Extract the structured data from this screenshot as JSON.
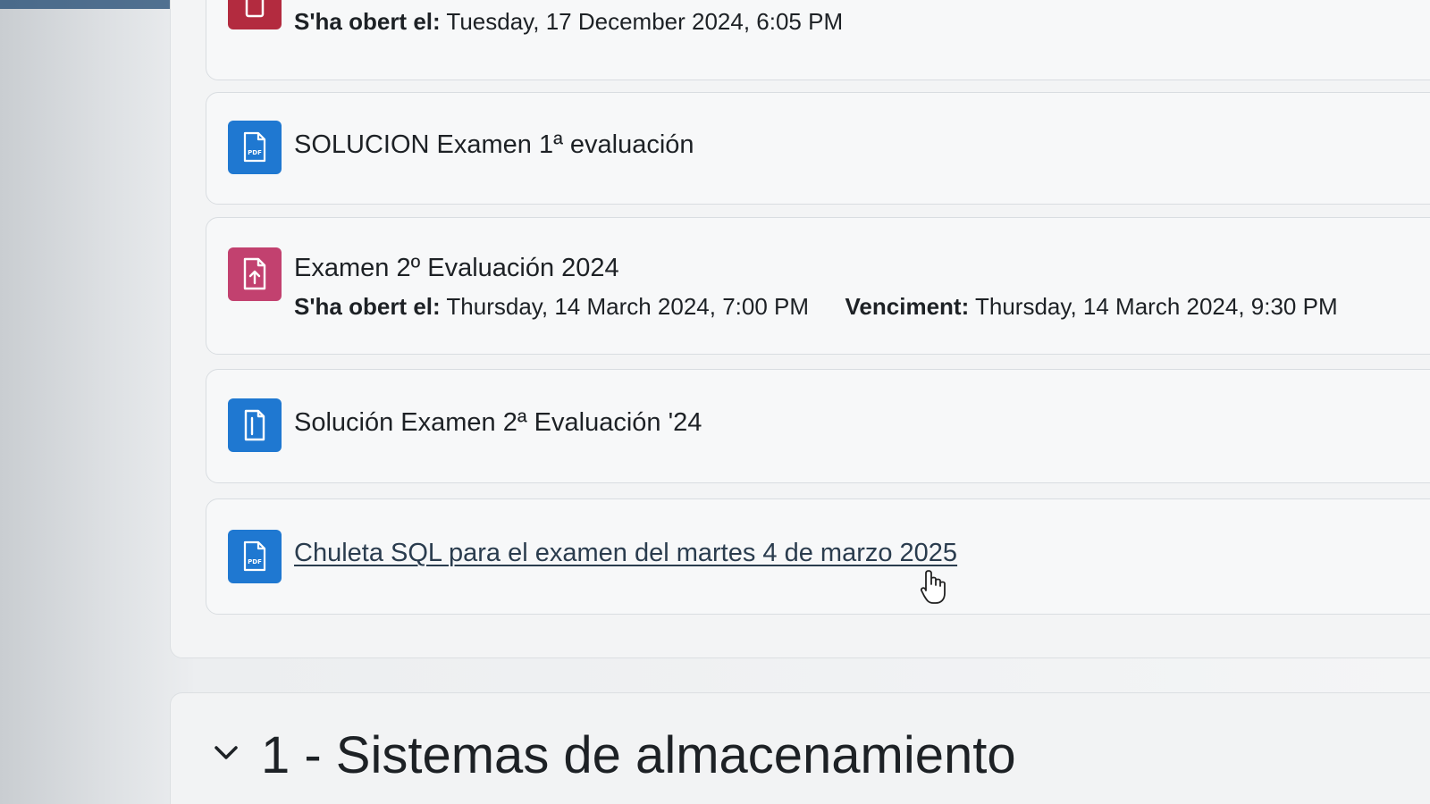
{
  "activities": [
    {
      "title": "",
      "meta": {
        "opened_label": "S'ha obert el:",
        "opened_value": "Tuesday, 17 December 2024, 6:05 PM"
      },
      "icon": "assignment-icon",
      "icon_color": "#b32b3f"
    },
    {
      "title": "SOLUCION Examen 1ª evaluación",
      "icon": "pdf-icon",
      "icon_color": "#1f78d1"
    },
    {
      "title": "Examen 2º Evaluación 2024",
      "meta": {
        "opened_label": "S'ha obert el:",
        "opened_value": "Thursday, 14 March 2024, 7:00 PM",
        "due_label": "Venciment:",
        "due_value": "Thursday, 14 March 2024, 9:30 PM"
      },
      "icon": "assignment-upload-icon",
      "icon_color": "#c2416f"
    },
    {
      "title": "Solución Examen 2ª Evaluación '24",
      "icon": "document-icon",
      "icon_color": "#1f78d1"
    },
    {
      "title": "Chuleta SQL para el examen del martes 4 de marzo 2025",
      "icon": "pdf-icon",
      "icon_color": "#1f78d1"
    }
  ],
  "section": {
    "title": "1 - Sistemas de almacenamiento",
    "toggle_icon": "chevron-down-icon"
  },
  "cursor": {
    "icon": "hand-pointer-icon"
  }
}
